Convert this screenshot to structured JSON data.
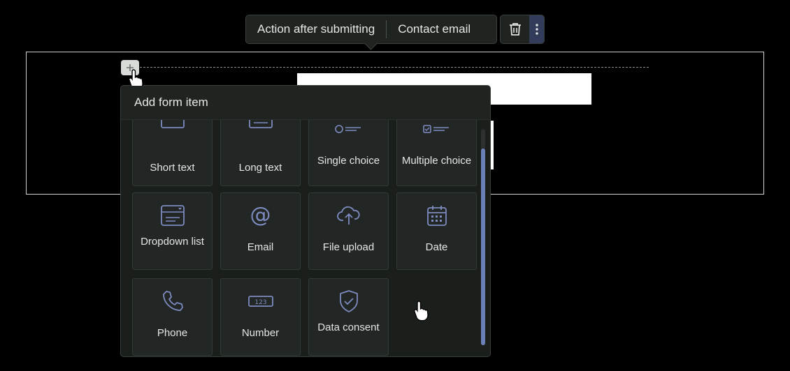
{
  "toolbar": {
    "action_label": "Action after submitting",
    "contact_label": "Contact email",
    "delete_icon": "trash-icon",
    "more_icon": "more-vertical-icon"
  },
  "popup": {
    "title": "Add form item",
    "items": [
      {
        "label": "Short text",
        "icon": "short-text-icon"
      },
      {
        "label": "Long text",
        "icon": "long-text-icon"
      },
      {
        "label": "Single choice",
        "icon": "single-choice-icon"
      },
      {
        "label": "Multiple choice",
        "icon": "multiple-choice-icon"
      },
      {
        "label": "Dropdown list",
        "icon": "dropdown-list-icon"
      },
      {
        "label": "Email",
        "icon": "at-icon"
      },
      {
        "label": "File upload",
        "icon": "cloud-upload-icon"
      },
      {
        "label": "Date",
        "icon": "calendar-icon"
      },
      {
        "label": "Phone",
        "icon": "phone-icon"
      },
      {
        "label": "Number",
        "icon": "number-icon"
      },
      {
        "label": "Data consent",
        "icon": "shield-check-icon"
      }
    ]
  },
  "colors": {
    "accent": "#6b7fb8",
    "background": "#000000",
    "card": "#222725"
  }
}
